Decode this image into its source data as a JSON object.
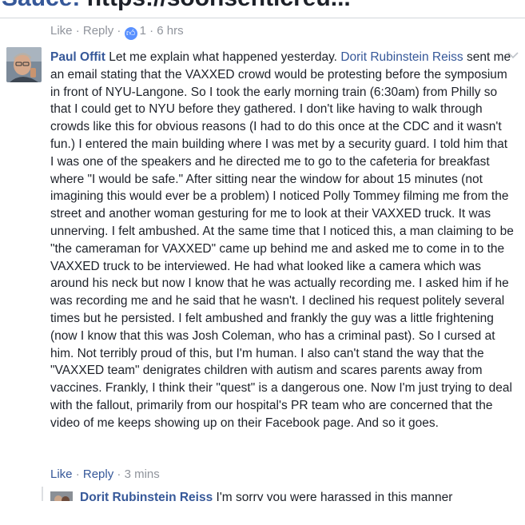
{
  "header_cut": {
    "partial_text": "Sauce: https://soonsenticreu...",
    "link_part": "Sauce:"
  },
  "previous_comment": {
    "like_label": "Like",
    "reply_label": "Reply",
    "like_count": "1",
    "timestamp": "6 hrs"
  },
  "comment": {
    "author": "Paul Offit",
    "mention": "Dorit Rubinstein Reiss",
    "text_before_mention": "Let me explain what happened yesterday.",
    "text_after_mention": "sent me an email stating that the VAXXED crowd would be protesting before the symposium in front of NYU-Langone. So I took the early morning train (6:30am) from Philly so that I could get to NYU before they gathered. I don't like having to walk through crowds like this for obvious reasons (I had to do this once at the CDC and it wasn't fun.) I entered the main building where I was met by a security guard. I told him that I was one of the speakers and he directed me to go to the cafeteria for breakfast where \"I would be safe.\" After sitting near the window for about 15 minutes (not imagining this would ever be a problem) I noticed Polly Tommey filming me from the street and another woman gesturing for me to look at their VAXXED truck. It was unnerving. I felt ambushed. At the same time that I noticed this, a man claiming to be \"the cameraman for VAXXED\" came up behind me and asked me to come in to the VAXXED truck to be interviewed. He had what looked like a camera which was around his neck but now I know that he was actually recording me. I asked him if he was recording me and he said that he wasn't. I declined his request politely several times but he persisted. I felt ambushed and frankly the guy was a little frightening (now I know that this was Josh Coleman, who has a criminal past). So I cursed at him. Not terribly proud of this, but I'm human. I also can't stand the way that the \"VAXXED team\" denigrates children with autism and scares parents away from vaccines. Frankly, I think their \"quest\" is a dangerous one. Now I'm just trying to deal with the fallout, primarily from our hospital's PR team who are concerned that the video of me keeps showing up on their Facebook page. And so it goes.",
    "like_label": "Like",
    "reply_label": "Reply",
    "timestamp": "3 mins"
  },
  "reply_preview": {
    "author": "Dorit Rubinstein Reiss",
    "text": "I'm sorry you were harassed in this manner"
  },
  "icons": {
    "avatar": "avatar-photo",
    "options": "chevron-down-icon",
    "like_badge": "thumbs-up-icon"
  },
  "colors": {
    "link": "#365899",
    "meta": "#90949c",
    "text": "#1d2129",
    "like_badge": "#5890ff"
  }
}
